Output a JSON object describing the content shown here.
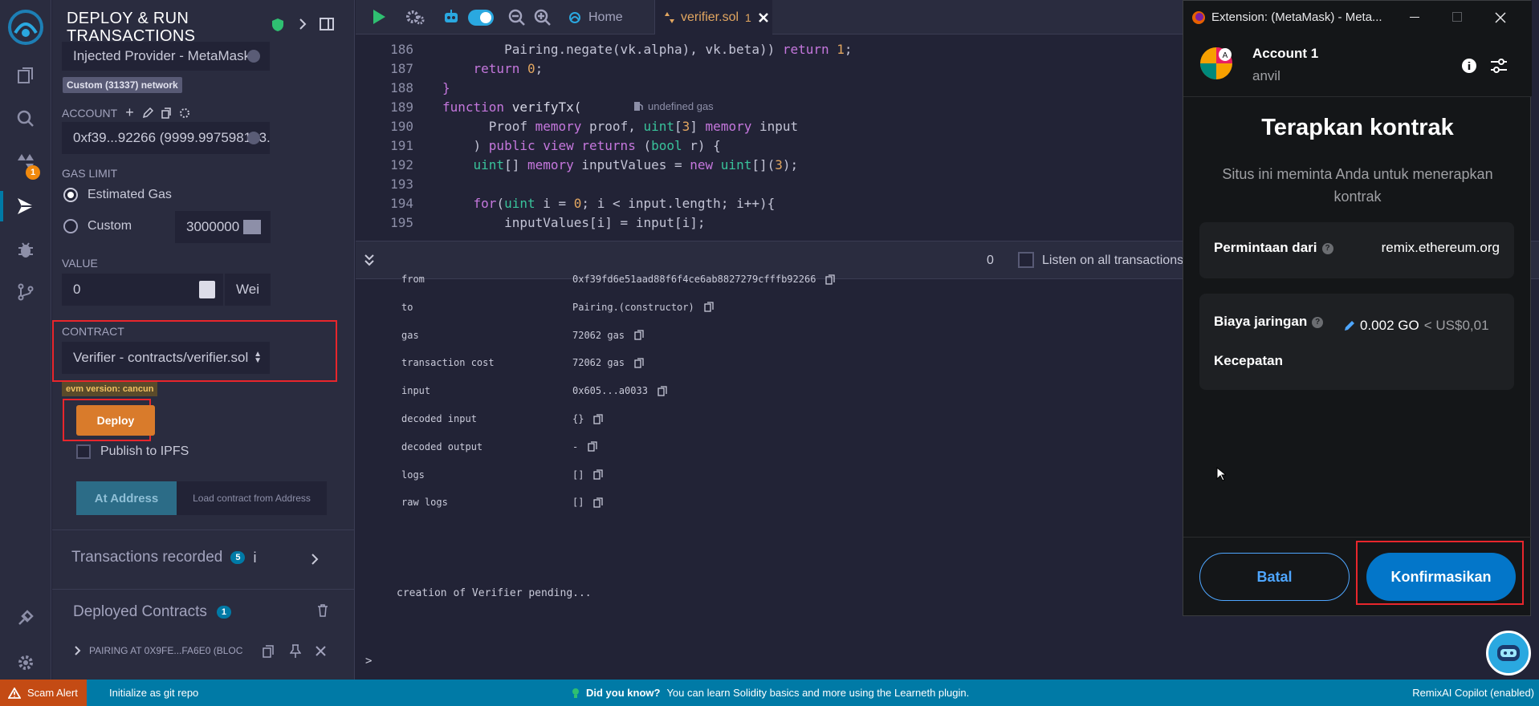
{
  "panel": {
    "title_line1": "DEPLOY & RUN",
    "title_line2": "TRANSACTIONS",
    "environment": "Injected Provider - MetaMask",
    "network_badge": "Custom (31337) network",
    "account_label": "ACCOUNT",
    "account_value": "0xf39...92266 (9999.997598133...",
    "gas_limit_label": "GAS LIMIT",
    "estimated_gas": "Estimated Gas",
    "custom_gas": "Custom",
    "custom_gas_value": "3000000",
    "value_label": "VALUE",
    "value_amount": "0",
    "value_unit": "Wei",
    "contract_label": "CONTRACT",
    "contract_value": "Verifier - contracts/verifier.sol",
    "evm_badge": "evm version: cancun",
    "deploy_label": "Deploy",
    "publish_ipfs": "Publish to IPFS",
    "at_address": "At Address",
    "load_contract": "Load contract from Address",
    "tx_recorded": "Transactions recorded",
    "tx_recorded_count": "5",
    "tx_recorded_info": "i",
    "deployed_contracts": "Deployed Contracts",
    "deployed_count": "1",
    "deployed_item": "PAIRING AT 0X9FE...FA6E0 (BLOC"
  },
  "rail": {
    "plugin_badge": "1"
  },
  "tabs": {
    "home": "Home",
    "file": "verifier.sol",
    "file_badge": "1"
  },
  "code": {
    "gas_hint": "undefined gas",
    "lines": [
      {
        "n": "186",
        "parts": [
          [
            "",
            "        Pairing.negate(vk.alpha), vk.beta)) "
          ],
          [
            "kw",
            "return "
          ],
          [
            "num",
            "1"
          ],
          [
            "",
            ";"
          ]
        ]
      },
      {
        "n": "187",
        "parts": [
          [
            "",
            "    "
          ],
          [
            "kw",
            "return "
          ],
          [
            "num",
            "0"
          ],
          [
            "",
            ";"
          ]
        ]
      },
      {
        "n": "188",
        "parts": [
          [
            "kw",
            "}"
          ]
        ]
      },
      {
        "n": "189",
        "parts": [
          [
            "kw",
            "function "
          ],
          [
            "fn",
            "verifyTx("
          ]
        ]
      },
      {
        "n": "190",
        "parts": [
          [
            "",
            "      Proof "
          ],
          [
            "kw",
            "memory "
          ],
          [
            "",
            "proof, "
          ],
          [
            "ty",
            "uint"
          ],
          [
            "",
            "["
          ],
          [
            "num",
            "3"
          ],
          [
            "",
            "] "
          ],
          [
            "kw",
            "memory "
          ],
          [
            "",
            "input"
          ]
        ]
      },
      {
        "n": "191",
        "parts": [
          [
            "",
            "    ) "
          ],
          [
            "kw",
            "public view returns "
          ],
          [
            "",
            "("
          ],
          [
            "ty",
            "bool "
          ],
          [
            "",
            "r) {"
          ]
        ]
      },
      {
        "n": "192",
        "parts": [
          [
            "",
            "    "
          ],
          [
            "ty",
            "uint"
          ],
          [
            "",
            "[] "
          ],
          [
            "kw",
            "memory "
          ],
          [
            "",
            "inputValues = "
          ],
          [
            "kw",
            "new "
          ],
          [
            "ty",
            "uint"
          ],
          [
            "",
            "[]("
          ],
          [
            "num",
            "3"
          ],
          [
            "",
            ");"
          ]
        ]
      },
      {
        "n": "193",
        "parts": [
          [
            "",
            ""
          ]
        ]
      },
      {
        "n": "194",
        "parts": [
          [
            "",
            "    "
          ],
          [
            "kw",
            "for"
          ],
          [
            "",
            "("
          ],
          [
            "ty",
            "uint "
          ],
          [
            "",
            "i = "
          ],
          [
            "num",
            "0"
          ],
          [
            "",
            "; i < input.length; i++){"
          ]
        ]
      },
      {
        "n": "195",
        "parts": [
          [
            "",
            "        inputValues[i] = input[i];"
          ]
        ]
      }
    ]
  },
  "terminal": {
    "count": "0",
    "listen_label": "Listen on all transactions",
    "rows": [
      {
        "key": "from",
        "value": "0xf39fd6e51aad88f6f4ce6ab8827279cfffb92266"
      },
      {
        "key": "to",
        "value": "Pairing.(constructor)"
      },
      {
        "key": "gas",
        "value": "72062 gas"
      },
      {
        "key": "transaction cost",
        "value": "72062 gas"
      },
      {
        "key": "input",
        "value": "0x605...a0033"
      },
      {
        "key": "decoded input",
        "value": "{}"
      },
      {
        "key": "decoded output",
        "value": " - "
      },
      {
        "key": "logs",
        "value": "[]"
      },
      {
        "key": "raw logs",
        "value": "[]"
      }
    ],
    "pending": "creation of Verifier pending...",
    "prompt": ">"
  },
  "status": {
    "scam_alert": "Scam Alert",
    "git": "Initialize as git repo",
    "did_you_know": "Did you know?",
    "tip": "You can learn Solidity basics and more using the Learneth plugin.",
    "copilot": "RemixAI Copilot (enabled)"
  },
  "metamask": {
    "window_title": "Extension: (MetaMask) - Meta...",
    "account_name": "Account 1",
    "network": "anvil",
    "heading": "Terapkan kontrak",
    "subtitle": "Situs ini meminta Anda untuk menerapkan kontrak",
    "request_from_label": "Permintaan dari",
    "request_from_value": "remix.ethereum.org",
    "network_fee_label": "Biaya jaringan",
    "network_fee_value": "0.002 GO",
    "network_fee_fiat": "< US$0,01",
    "speed_label": "Kecepatan",
    "cancel": "Batal",
    "confirm": "Konfirmasikan"
  },
  "colors": {
    "accent": "#007aa6",
    "deploy": "#d97b2b",
    "highlight_box": "#e8262c",
    "metamask_primary": "#0376c9"
  }
}
